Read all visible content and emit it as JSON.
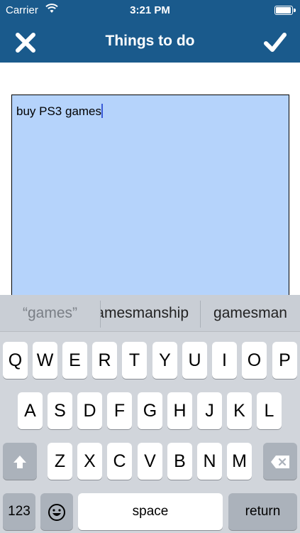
{
  "status_bar": {
    "carrier": "Carrier",
    "time": "3:21 PM",
    "battery_level": 0.95
  },
  "nav": {
    "title": "Things to do",
    "close_icon": "close-x-icon",
    "done_icon": "checkmark-icon",
    "bar_color": "#1a5a8c"
  },
  "editor": {
    "value": "buy PS3 games",
    "highlight_color": "#b5d3fb"
  },
  "suggestions": [
    "“games”",
    "gamesmanship",
    "gamesman"
  ],
  "keyboard": {
    "row1": [
      "Q",
      "W",
      "E",
      "R",
      "T",
      "Y",
      "U",
      "I",
      "O",
      "P"
    ],
    "row2": [
      "A",
      "S",
      "D",
      "F",
      "G",
      "H",
      "J",
      "K",
      "L"
    ],
    "row3": [
      "Z",
      "X",
      "C",
      "V",
      "B",
      "N",
      "M"
    ],
    "numbers_label": "123",
    "space_label": "space",
    "return_label": "return",
    "shift_icon": "shift-arrow-icon",
    "delete_icon": "backspace-icon",
    "emoji_icon": "emoji-face-icon"
  }
}
